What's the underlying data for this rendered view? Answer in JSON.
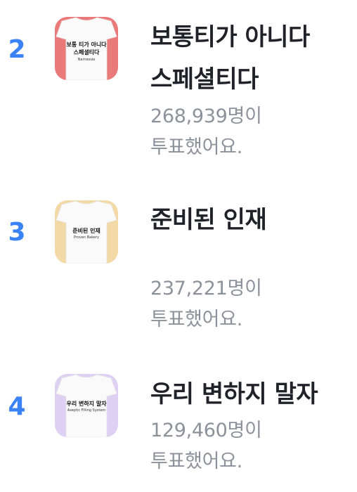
{
  "ranking": [
    {
      "rank": "2",
      "title_line1": "보통티가 아니다",
      "title_line2": "스페셜티다",
      "votes_line1": "268,939명이",
      "votes_line2": "투표했어요.",
      "thumb_text_line1": "보통 티가 아니다",
      "thumb_text_line2": "스페셜티다",
      "thumb_sub": "Narnessie",
      "accent_color": "#ea7a7a"
    },
    {
      "rank": "3",
      "title_line1": "준비된 인재",
      "votes_line1": "237,221명이",
      "votes_line2": "투표했어요.",
      "thumb_text_line1": "준비된 인재",
      "thumb_sub": "Proven Bakery",
      "accent_color": "#f3d9a6"
    },
    {
      "rank": "4",
      "title_line1": "우리 변하지 말자",
      "votes_line1": "129,460명이",
      "votes_line2": "투표했어요.",
      "thumb_text_line1": "우리 변하지 말자",
      "thumb_sub": "Aseptic Filling System",
      "accent_color": "#ddd0f2"
    }
  ],
  "colors": {
    "rank_number": "#3b82f6",
    "title": "#1f2329",
    "votes": "#8b929b"
  },
  "icons": [
    "tshirt-thumbnail"
  ]
}
